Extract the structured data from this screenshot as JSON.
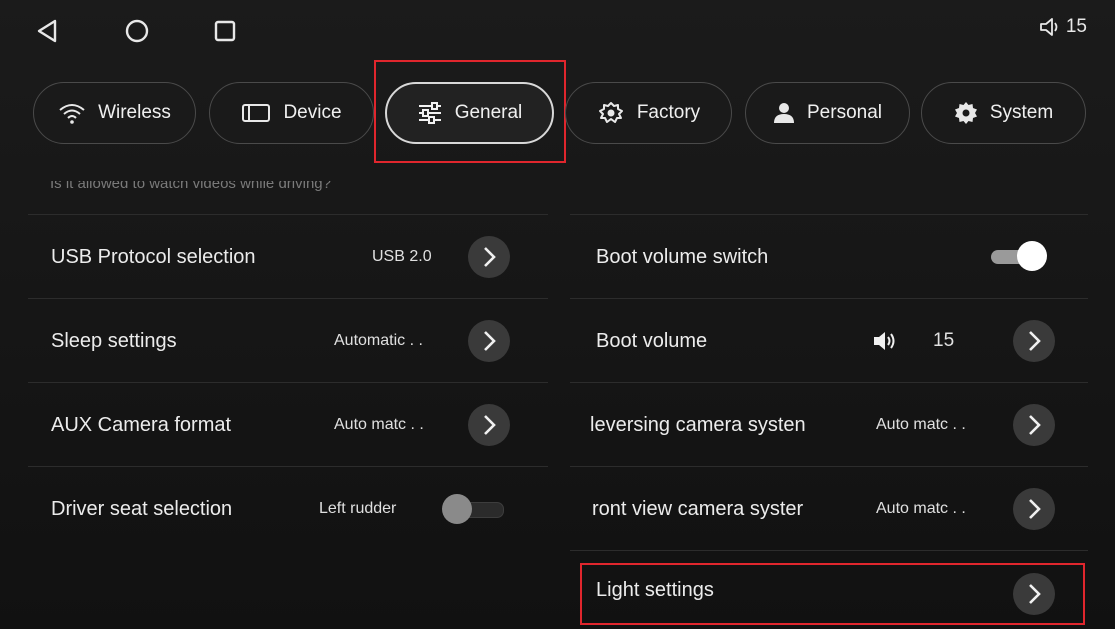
{
  "status": {
    "volume_level": "15"
  },
  "tabs": [
    {
      "label": "Wireless",
      "icon": "wifi-icon"
    },
    {
      "label": "Device",
      "icon": "device-icon"
    },
    {
      "label": "General",
      "icon": "sliders-icon",
      "active": true
    },
    {
      "label": "Factory",
      "icon": "factory-icon"
    },
    {
      "label": "Personal",
      "icon": "person-icon"
    },
    {
      "label": "System",
      "icon": "gear-icon"
    }
  ],
  "left_panel": {
    "faded_text": "Is it allowed to watch videos while driving?",
    "rows": [
      {
        "label": "USB Protocol selection",
        "value": "USB 2.0"
      },
      {
        "label": "Sleep settings",
        "value": "Automatic . ."
      },
      {
        "label": "AUX Camera format",
        "value": "Auto matc . ."
      },
      {
        "label": "Driver seat selection",
        "value": "Left rudder",
        "toggle": false
      }
    ]
  },
  "right_panel": {
    "rows": [
      {
        "label": "Boot volume switch",
        "toggle": true
      },
      {
        "label": "Boot volume",
        "value": "15",
        "icon": "speaker-icon"
      },
      {
        "label": "everse camera systen",
        "display": "leversing camera systen",
        "value": "Auto matc . ."
      },
      {
        "label": "ront view camera syster",
        "value": "Auto matc . ."
      },
      {
        "label": "Light settings"
      }
    ]
  },
  "colors": {
    "background": "#141414",
    "highlight": "#e0262d",
    "chevron_bg": "#3a3a3a"
  }
}
